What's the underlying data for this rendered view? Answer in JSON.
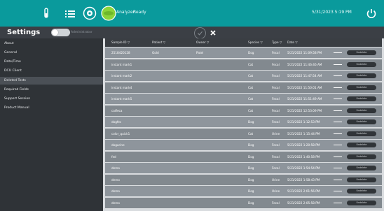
{
  "topbar": {
    "icons": [
      "tube-icon",
      "list-icon",
      "target-icon",
      "logo-icon",
      "power-icon"
    ],
    "logo_text": "Analyzer",
    "status": "Ready",
    "datetime": "5/31/2023 5:19 PM",
    "colors": {
      "bg": "#0a9a9c",
      "logo": "#8bd43a"
    }
  },
  "settings": {
    "title": "Settings",
    "toggle_label": "Administrator"
  },
  "sidebar": {
    "items": [
      {
        "label": "About"
      },
      {
        "label": "General"
      },
      {
        "label": "Date/Time"
      },
      {
        "label": "DCU Client"
      },
      {
        "label": "Deleted Tests",
        "active": true
      },
      {
        "label": "Required Fields"
      },
      {
        "label": "Support Session"
      },
      {
        "label": "Product Manual"
      }
    ]
  },
  "table": {
    "headers": [
      "Sample ID",
      "Patient",
      "Owner",
      "Species",
      "Type",
      "Date"
    ],
    "undelete_label": "Undelete",
    "rows": [
      {
        "sample": "2518420128",
        "patient": "Gold",
        "owner": "Patel",
        "species": "Dog",
        "type": "Fecal",
        "date": "5/21/2022 11:09:58 PM"
      },
      {
        "sample": "instant mark1",
        "patient": "",
        "owner": "",
        "species": "Cat",
        "type": "Fecal",
        "date": "5/21/2022 11:46:46 AM"
      },
      {
        "sample": "instant mark2",
        "patient": "",
        "owner": "",
        "species": "Cat",
        "type": "Fecal",
        "date": "5/21/2022 11:47:54 AM"
      },
      {
        "sample": "instant mark4",
        "patient": "",
        "owner": "",
        "species": "Cat",
        "type": "Fecal",
        "date": "5/21/2022 11:50:01 AM"
      },
      {
        "sample": "instant mark5",
        "patient": "",
        "owner": "",
        "species": "Cat",
        "type": "Fecal",
        "date": "5/21/2022 11:51:49 AM"
      },
      {
        "sample": "catfeca",
        "patient": "",
        "owner": "",
        "species": "Cat",
        "type": "Fecal",
        "date": "5/21/2022 12:53:09 PM"
      },
      {
        "sample": "dogfec",
        "patient": "",
        "owner": "",
        "species": "Dog",
        "type": "Fecal",
        "date": "5/21/2022 1:12:53 PM"
      },
      {
        "sample": "color_quick1",
        "patient": "",
        "owner": "",
        "species": "Cat",
        "type": "Urine",
        "date": "5/21/2022 1:15:44 PM"
      },
      {
        "sample": "dogurine",
        "patient": "",
        "owner": "",
        "species": "Dog",
        "type": "Fecal",
        "date": "5/21/2022 1:20:58 PM"
      },
      {
        "sample": "fed",
        "patient": "",
        "owner": "",
        "species": "Dog",
        "type": "Fecal",
        "date": "5/21/2022 1:40:58 PM"
      },
      {
        "sample": "demo",
        "patient": "",
        "owner": "",
        "species": "Dog",
        "type": "Fecal",
        "date": "5/21/2022 1:54:54 PM"
      },
      {
        "sample": "demo",
        "patient": "",
        "owner": "",
        "species": "Dog",
        "type": "Urine",
        "date": "5/21/2022 1:58:43 PM"
      },
      {
        "sample": "demo",
        "patient": "",
        "owner": "",
        "species": "Dog",
        "type": "Urine",
        "date": "5/21/2022 2:01:56 PM"
      },
      {
        "sample": "demo",
        "patient": "",
        "owner": "",
        "species": "Dog",
        "type": "Fecal",
        "date": "5/21/2022 2:05:58 PM"
      }
    ]
  }
}
